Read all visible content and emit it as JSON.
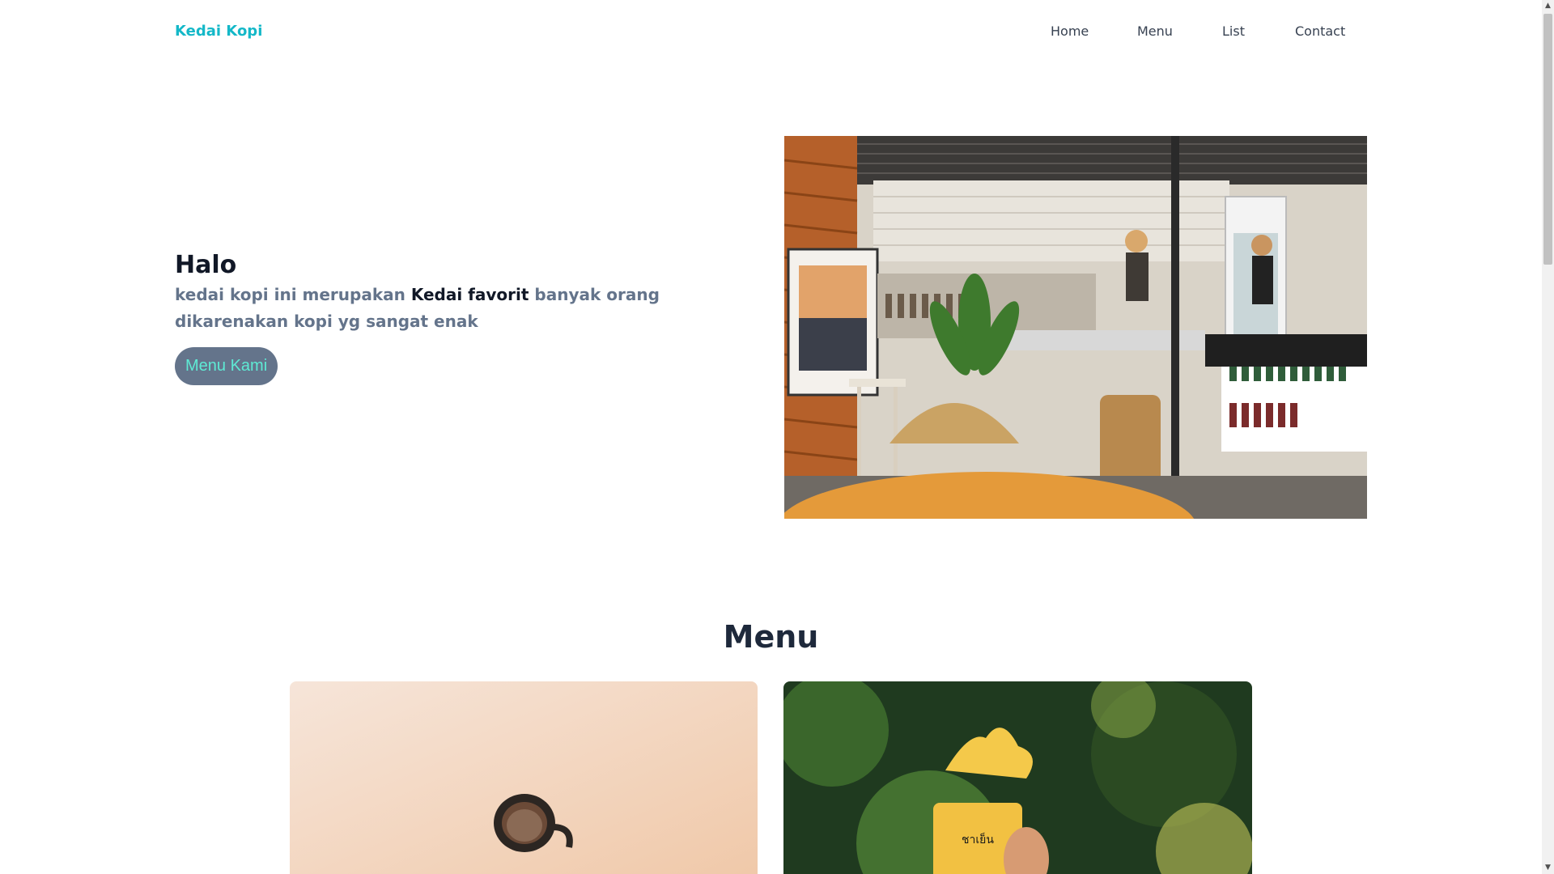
{
  "navbar": {
    "brand": "Kedai Kopi",
    "links": [
      "Home",
      "Menu",
      "List",
      "Contact"
    ]
  },
  "hero": {
    "title": "Halo",
    "desc_part1": "kedai kopi ini merupakan ",
    "desc_strong": "Kedai favorit",
    "desc_part2": " banyak orang dikarenakan kopi yg sangat enak",
    "button": "Menu Kami",
    "image": "cafe-interior-photo"
  },
  "menu": {
    "heading": "Menu",
    "cards": [
      {
        "image": "coffee-cup-photo"
      },
      {
        "image": "iced-drink-splash-photo"
      }
    ]
  },
  "colors": {
    "brand": "#14b8c8",
    "text_muted": "#64748b",
    "button_bg": "#64748b",
    "button_text": "#5eead4",
    "heading": "#1e293b"
  }
}
